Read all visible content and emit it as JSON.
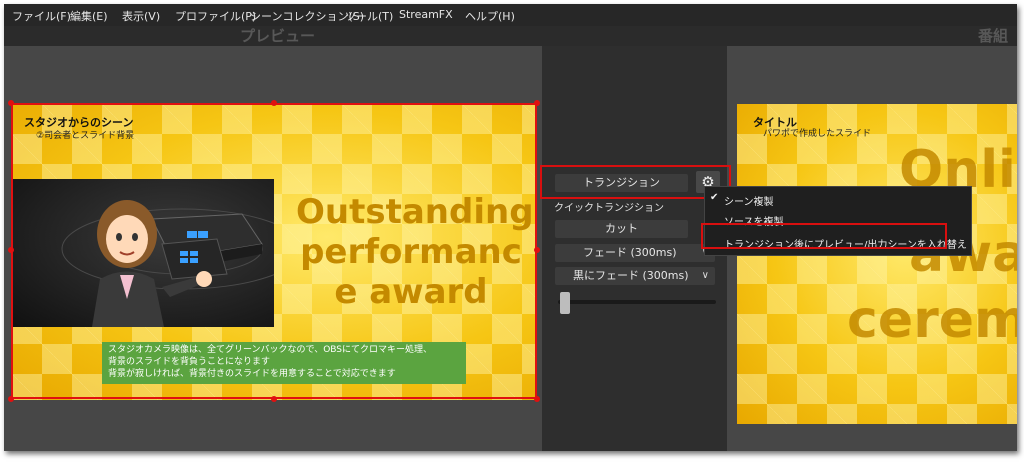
{
  "menubar": {
    "items": [
      "ファイル(F)",
      "編集(E)",
      "表示(V)",
      "プロファイル(P)",
      "シーンコレクション(S)",
      "ツール(T)",
      "StreamFX",
      "ヘルプ(H)"
    ]
  },
  "preview": {
    "title": "プレビュー",
    "scene_title": "スタジオからのシーン",
    "scene_subtitle": "②司会者とスライド背景",
    "award_lines": [
      "Outstanding",
      "performanc",
      "e award"
    ],
    "note_lines": [
      "スタジオカメラ映像は、全てグリーンバックなので、OBSにてクロマキー処理、",
      "背景のスライドを背負うことになります",
      "背景が寂しければ、背景付きのスライドを用意することで対応できます"
    ]
  },
  "program": {
    "title": "番組",
    "scene_title": "タイトル",
    "scene_subtitle": "パワポで作成したスライド",
    "big_lines": [
      "Onli",
      "awa",
      "cerem"
    ]
  },
  "transition": {
    "button_label": "トランジション",
    "quick_label": "クイックトランジション",
    "cut_label": "カット",
    "fade_label": "フェード (300ms)",
    "fade_black_label": "黒にフェード (300ms)",
    "slider_value": 0
  },
  "context_menu": {
    "items": [
      {
        "label": "シーン複製",
        "checked": true
      },
      {
        "label": "ソースを複製",
        "checked": false
      },
      {
        "label": "トランジション後にプレビュー/出力シーンを入れ替え",
        "checked": false
      }
    ]
  },
  "colors": {
    "highlight": "#d80f0f",
    "note_bg": "#5ba440",
    "award_text": "#c48a00"
  },
  "icons": {
    "gear": "gear-icon",
    "check": "check-icon"
  }
}
